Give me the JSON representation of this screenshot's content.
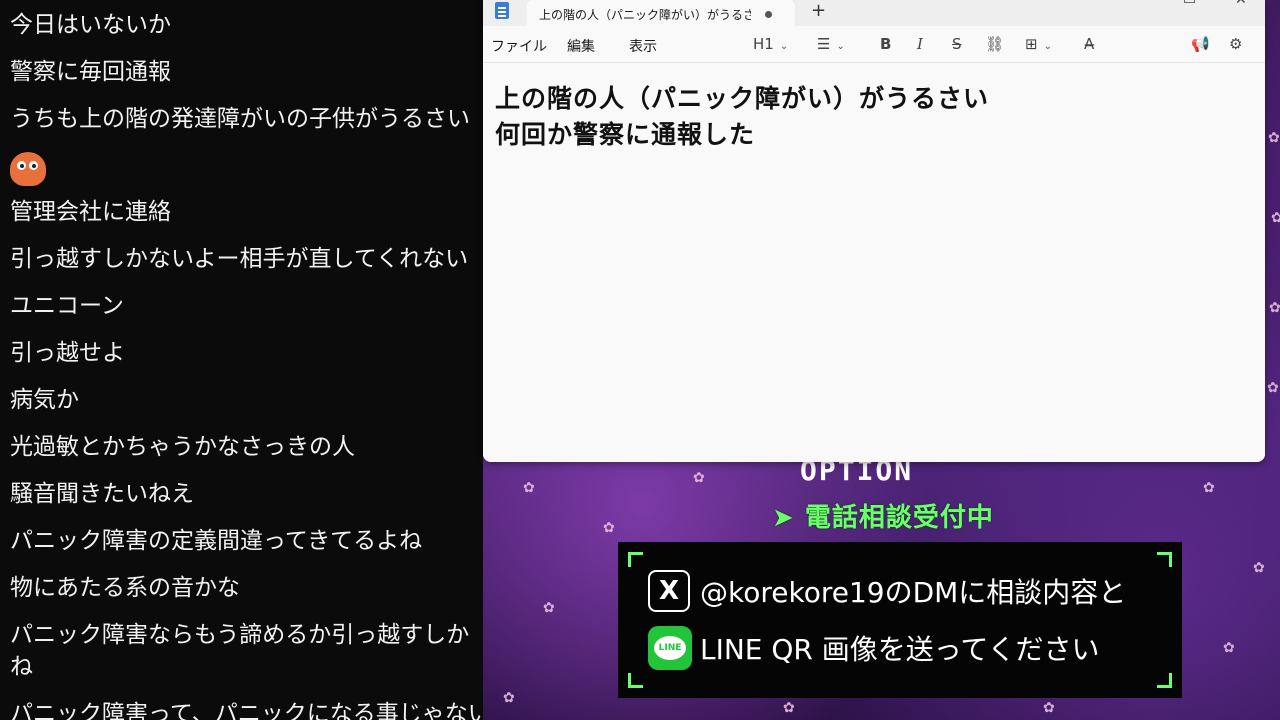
{
  "chat": {
    "lines": [
      "今日はいないか",
      "警察に毎回通報",
      "うちも上の階の発達障がいの子供がうるさい",
      "管理会社に連絡",
      "引っ越すしかないよー相手が直してくれない",
      "ユニコーン",
      "引っ越せよ",
      "病気か",
      "光過敏とかちゃうかなさっきの人",
      "騒音聞きたいねえ",
      "パニック障害の定義間違ってきてるよね",
      "物にあたる系の音かな",
      "パニック障害ならもう諦めるか引っ越すしか",
      "ね",
      "パニック障害って、パニックになる事じゃない"
    ]
  },
  "notepad": {
    "tab_title": "上の階の人（パニック障がい）がうるさい",
    "new_tab": "+",
    "menu": {
      "file": "ファイル",
      "edit": "編集",
      "view": "表示"
    },
    "toolbar": {
      "heading": "H1",
      "list": "☰",
      "bold": "B",
      "italic": "I",
      "strike": "S",
      "link": "⛓",
      "table": "⊞",
      "clear_format": "A̶",
      "copilot": "📢",
      "settings": "⚙"
    },
    "content": [
      "上の階の人（パニック障がい）がうるさい",
      "何回か警察に通報した"
    ]
  },
  "overlay": {
    "title": "OPTION",
    "hotline": "➤ 電話相談受付中",
    "row1": "@korekore19のDMに相談内容と",
    "row2": "LINE QR 画像を送ってください",
    "x_logo": "X",
    "line_logo": "LINE",
    "accent": "#6cff6c"
  }
}
